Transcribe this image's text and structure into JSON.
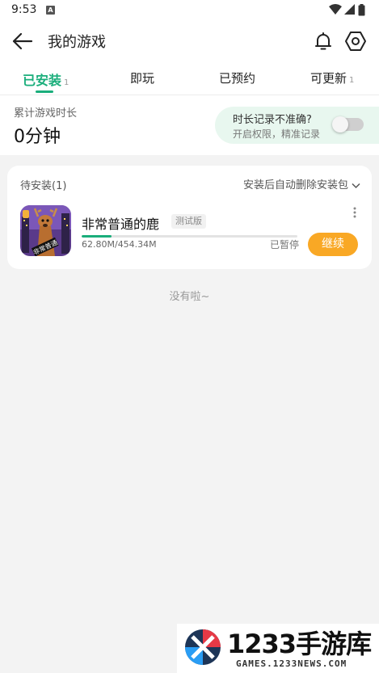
{
  "status_bar": {
    "time": "9:53",
    "notification_glyph": "A",
    "icons": [
      "wifi-icon",
      "signal-icon",
      "battery-icon"
    ]
  },
  "header": {
    "title": "我的游戏",
    "icons": [
      "back-arrow-icon",
      "bell-icon",
      "settings-icon"
    ]
  },
  "tabs": [
    {
      "label": "已安装",
      "count": "1",
      "active": true
    },
    {
      "label": "即玩",
      "count": "",
      "active": false
    },
    {
      "label": "已预约",
      "count": "",
      "active": false
    },
    {
      "label": "可更新",
      "count": "1",
      "active": false
    }
  ],
  "stats": {
    "label": "累计游戏时长",
    "value": "0分钟"
  },
  "notice": {
    "title": "时长记录不准确?",
    "subtitle": "开启权限，精准记录",
    "toggle_on": false
  },
  "pending": {
    "title": "待安装(1)",
    "auto_delete_label": "安装后自动删除安装包",
    "item": {
      "name": "非常普通的鹿",
      "badge": "测试版",
      "icon_text": "非常普通",
      "size_text": "62.80M/454.34M",
      "progress": 0.138,
      "status": "已暂停",
      "action_label": "继续"
    }
  },
  "empty_note": "没有啦~",
  "watermark": {
    "text": "1233手游库",
    "url": "GAMES.1233NEWS.COM"
  },
  "colors": {
    "accent": "#1aae7b",
    "action": "#f9a825",
    "notice_bg": "#e8f7ef",
    "page_bg": "#f3f3f3"
  }
}
